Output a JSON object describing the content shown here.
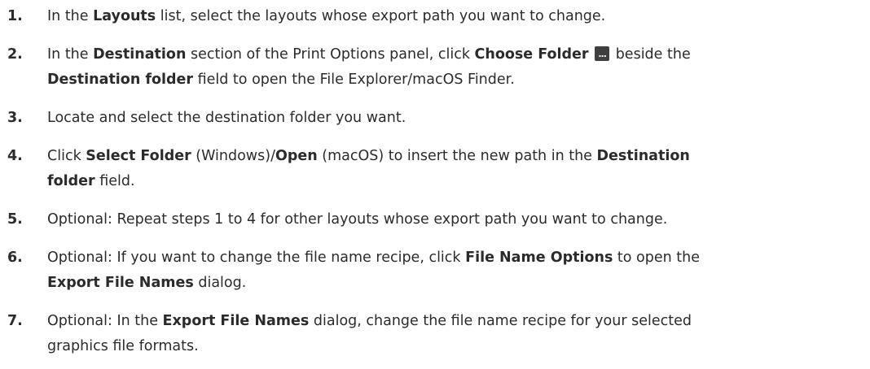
{
  "steps": [
    {
      "num": "1.",
      "parts": [
        "In the ",
        "Layouts",
        " list, select the layouts whose export path you want to change."
      ]
    },
    {
      "num": "2.",
      "parts": [
        "In the ",
        "Destination",
        " section of the Print Options panel, click ",
        "Choose Folder",
        " beside the",
        "Destination folder",
        " field to open the File Explorer/macOS Finder."
      ],
      "icon": "ellipsis-button-icon"
    },
    {
      "num": "3.",
      "parts": [
        "Locate and select the destination folder you want."
      ]
    },
    {
      "num": "4.",
      "parts": [
        "Click ",
        "Select Folder",
        " (Windows)/",
        "Open",
        " (macOS) to insert the new path in the ",
        "Destination",
        "folder",
        " field."
      ]
    },
    {
      "num": "5.",
      "parts": [
        "Optional: Repeat steps 1 to 4 for other layouts whose export path you want to change."
      ]
    },
    {
      "num": "6.",
      "parts": [
        "Optional: If you want to change the file name recipe, click ",
        "File Name Options",
        " to open the",
        "Export File Names",
        " dialog."
      ]
    },
    {
      "num": "7.",
      "parts": [
        "Optional: In the ",
        "Export File Names",
        " dialog, change the file name recipe for your selected",
        "graphics file formats."
      ]
    }
  ]
}
